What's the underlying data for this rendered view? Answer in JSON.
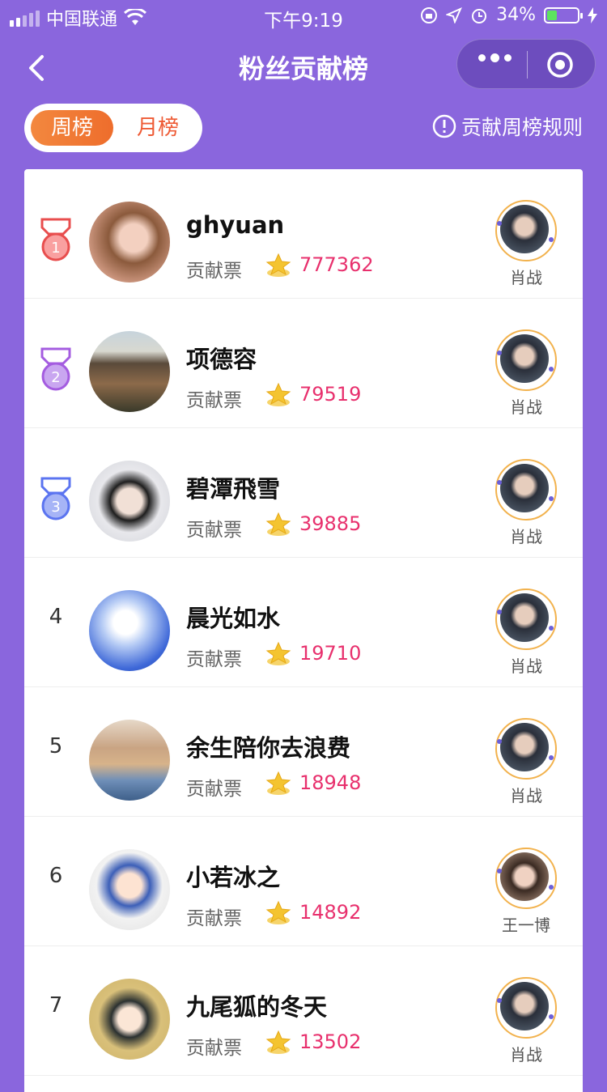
{
  "status": {
    "carrier": "中国联通",
    "time": "下午9:19",
    "battery_pct": "34%",
    "battery_level": 0.34
  },
  "header": {
    "title": "粉丝贡献榜"
  },
  "tabs": [
    {
      "label": "周榜",
      "active": true
    },
    {
      "label": "月榜",
      "active": false
    }
  ],
  "rules_link": "贡献周榜规则",
  "colors": {
    "background": "#8a66dd",
    "accent": "#f08040",
    "votes": "#e8306d",
    "medal1": "#e84e4e",
    "medal2": "#a45ce0",
    "medal3": "#5b74f0"
  },
  "rows": [
    {
      "rank": "1",
      "name": "ghyuan",
      "label": "贡献票",
      "votes": "777362",
      "idol": "肖战"
    },
    {
      "rank": "2",
      "name": "项德容",
      "label": "贡献票",
      "votes": "79519",
      "idol": "肖战"
    },
    {
      "rank": "3",
      "name": "碧潭飛雪",
      "label": "贡献票",
      "votes": "39885",
      "idol": "肖战"
    },
    {
      "rank": "4",
      "name": "晨光如水",
      "label": "贡献票",
      "votes": "19710",
      "idol": "肖战"
    },
    {
      "rank": "5",
      "name": "余生陪你去浪费",
      "label": "贡献票",
      "votes": "18948",
      "idol": "肖战"
    },
    {
      "rank": "6",
      "name": "小若冰之",
      "label": "贡献票",
      "votes": "14892",
      "idol": "王一博"
    },
    {
      "rank": "7",
      "name": "九尾狐的冬天",
      "label": "贡献票",
      "votes": "13502",
      "idol": "肖战"
    }
  ]
}
